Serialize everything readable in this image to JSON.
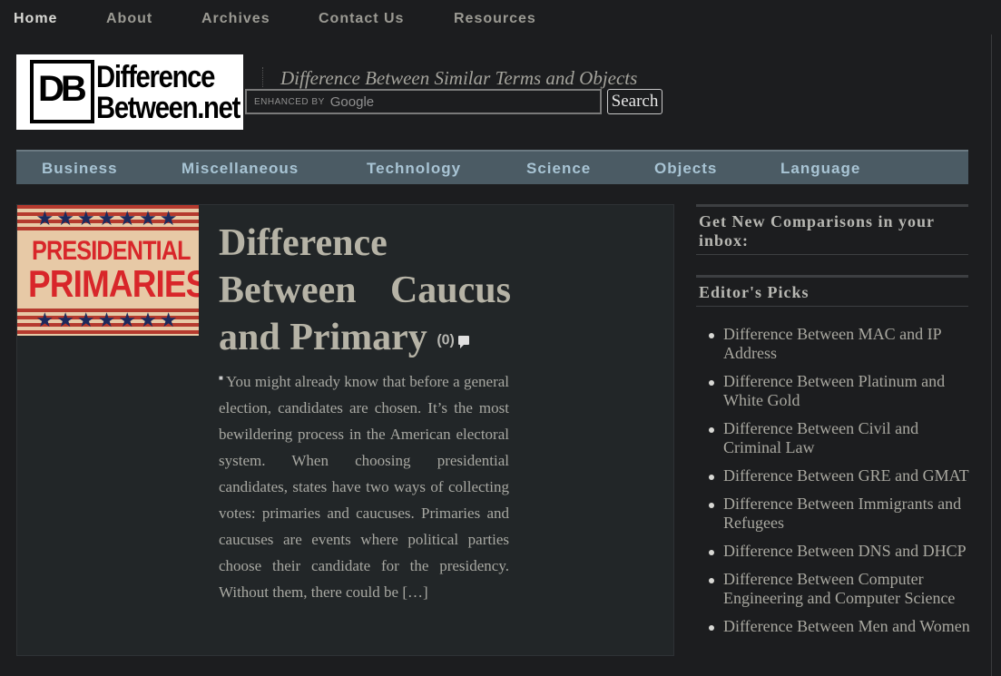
{
  "top_nav": [
    "Home",
    "About",
    "Archives",
    "Contact Us",
    "Resources"
  ],
  "logo": {
    "mark": "DB",
    "line1": "Difference",
    "line2": "Between.net"
  },
  "tagline": "Difference Between Similar Terms and Objects",
  "search": {
    "enhanced_by": "ENHANCED BY",
    "google": "Google",
    "button": "Search"
  },
  "categories": [
    "Business",
    "Miscellaneous",
    "Technology",
    "Science",
    "Objects",
    "Language"
  ],
  "article": {
    "thumb_line1": "PRESIDENTIAL",
    "thumb_line2": "PRIMARIES",
    "title_line1": "Difference",
    "title_line2a": "Between",
    "title_line2b": "Caucus",
    "title_line3": "and Primary",
    "comments": "(0)",
    "excerpt": "You might already know that before a general election, candidates are chosen. It’s the most bewildering process in the American electoral system. When choosing presidential candidates, states have two ways of collecting votes: primaries and caucuses. Primaries and caucuses are events where political parties choose their candidate for the presidency. Without them, there could be […]"
  },
  "sidebar": {
    "newsletter_title": "Get New Comparisons in your inbox:",
    "picks_title": "Editor's Picks",
    "picks": [
      "Difference Between MAC and IP Address",
      "Difference Between Platinum and White Gold",
      "Difference Between Civil and Criminal Law",
      "Difference Between GRE and GMAT",
      "Difference Between Immigrants and Refugees",
      "Difference Between DNS and DHCP",
      "Difference Between Computer Engineering and Computer Science",
      "Difference Between Men and Women"
    ]
  }
}
